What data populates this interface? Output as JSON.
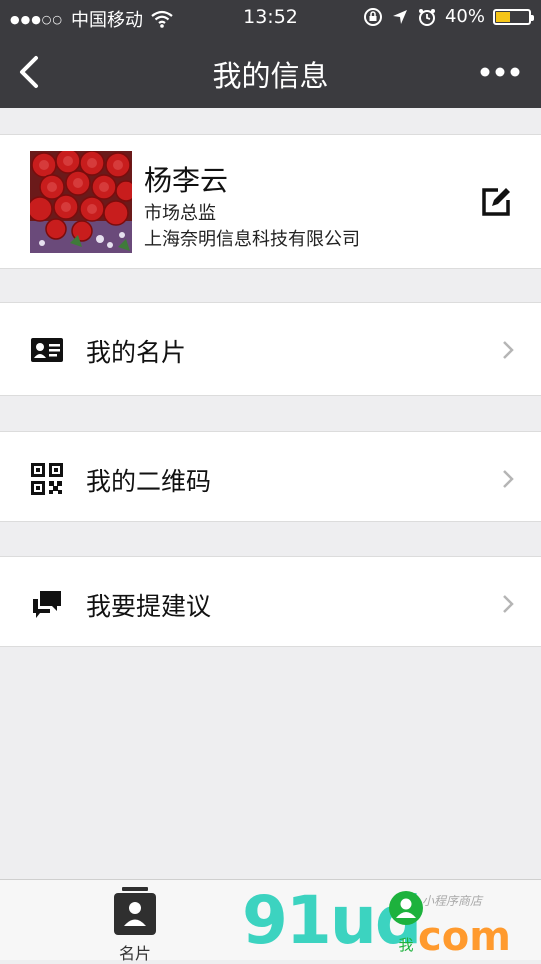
{
  "status_bar": {
    "carrier": "中国移动",
    "time": "13:52",
    "battery_percent": "40%",
    "battery_level": 0.4,
    "signal_dots": "●●●○○",
    "icons": [
      "wifi-icon",
      "orientation-lock-icon",
      "location-arrow-icon",
      "alarm-icon",
      "battery-icon"
    ]
  },
  "nav": {
    "title": "我的信息",
    "back_icon": "chevron-left-icon",
    "more_icon": "more-dots-icon"
  },
  "profile": {
    "name": "杨李云",
    "title": "市场总监",
    "company": "上海奈明信息科技有限公司",
    "avatar_image": "red-roses-photo",
    "edit_icon": "edit-icon"
  },
  "menu": [
    {
      "label": "我的名片",
      "icon": "id-card-icon"
    },
    {
      "label": "我的二维码",
      "icon": "qr-code-icon"
    },
    {
      "label": "我要提建议",
      "icon": "chat-bubbles-icon"
    }
  ],
  "tabbar": {
    "tabs": [
      {
        "label": "名片",
        "icon": "contact-card-icon"
      },
      {
        "label": "我",
        "icon": "user-icon"
      }
    ],
    "watermark": {
      "main": "91ud",
      "suffix": "com",
      "sub": "小程序商店"
    }
  },
  "colors": {
    "header_bg": "#3b3b3f",
    "page_bg": "#eeeef0",
    "accent_green": "#1db23d",
    "battery_fill": "#f5c518"
  }
}
